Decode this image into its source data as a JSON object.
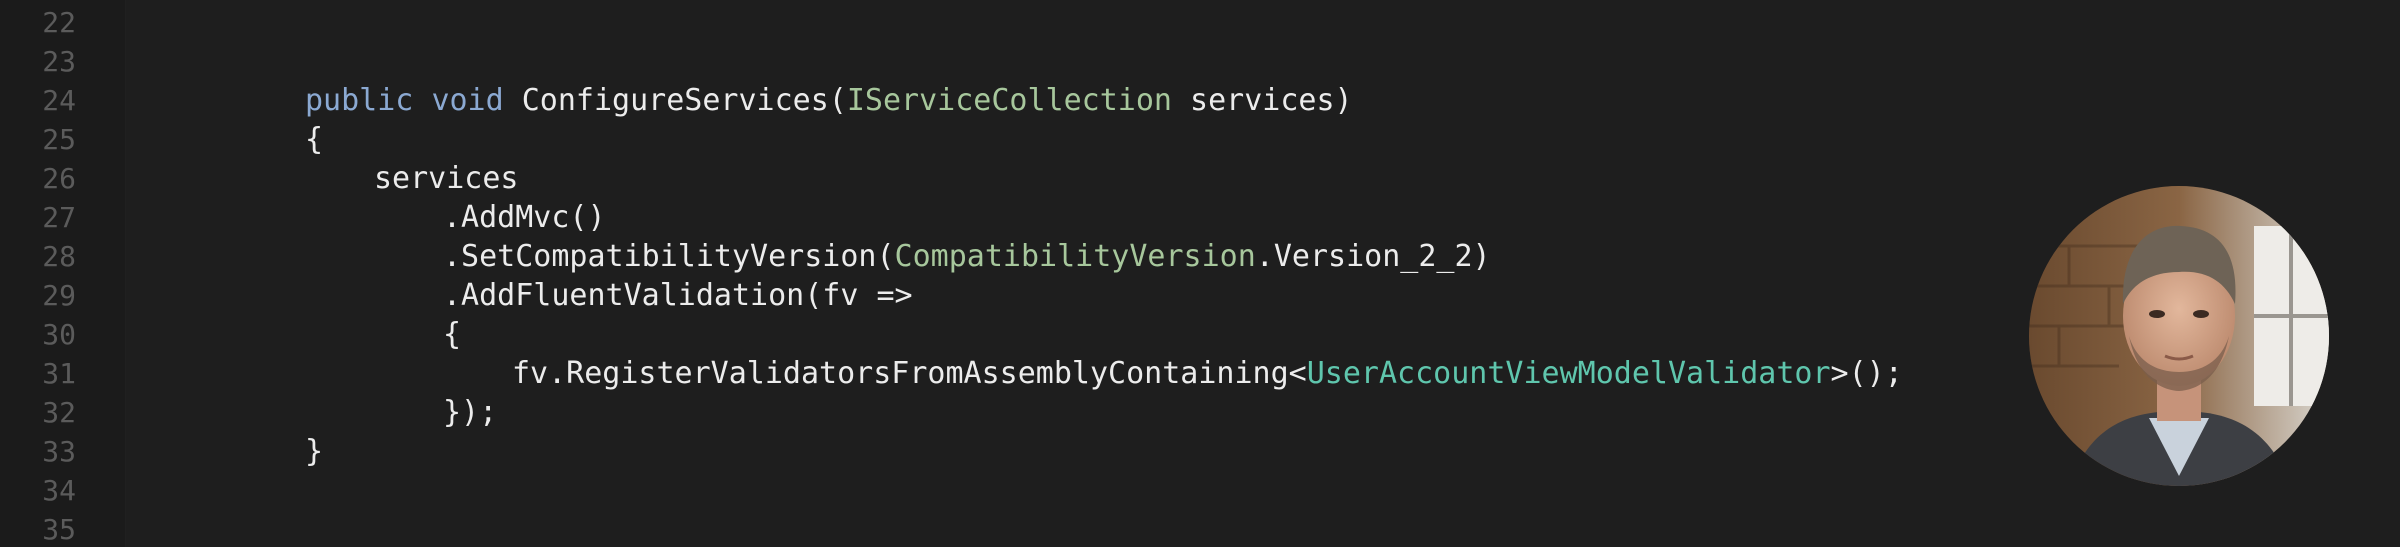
{
  "editor": {
    "line_numbers": [
      "22",
      "23",
      "24",
      "25",
      "26",
      "27",
      "28",
      "29",
      "30",
      "31",
      "32",
      "33",
      "34",
      "35"
    ],
    "lines": [
      {
        "segments": []
      },
      {
        "segments": []
      },
      {
        "indent": 2,
        "segments": [
          {
            "t": "public",
            "c": "kw"
          },
          {
            "t": " ",
            "c": "plain"
          },
          {
            "t": "void",
            "c": "kw"
          },
          {
            "t": " ConfigureServices(",
            "c": "plain"
          },
          {
            "t": "IServiceCollection",
            "c": "type"
          },
          {
            "t": " services)",
            "c": "plain"
          }
        ]
      },
      {
        "indent": 2,
        "segments": [
          {
            "t": "{",
            "c": "plain"
          }
        ]
      },
      {
        "indent": 3,
        "segments": [
          {
            "t": "services",
            "c": "plain"
          }
        ]
      },
      {
        "indent": 4,
        "segments": [
          {
            "t": ".AddMvc()",
            "c": "plain"
          }
        ]
      },
      {
        "indent": 4,
        "segments": [
          {
            "t": ".SetCompatibilityVersion(",
            "c": "plain"
          },
          {
            "t": "CompatibilityVersion",
            "c": "type"
          },
          {
            "t": ".Version_2_2)",
            "c": "plain"
          }
        ]
      },
      {
        "indent": 4,
        "segments": [
          {
            "t": ".AddFluentValidation(fv =>",
            "c": "plain"
          }
        ]
      },
      {
        "indent": 4,
        "segments": [
          {
            "t": "{",
            "c": "plain"
          }
        ]
      },
      {
        "indent": 5,
        "segments": [
          {
            "t": "fv.RegisterValidatorsFromAssemblyContaining<",
            "c": "plain"
          },
          {
            "t": "UserAccountViewModelValidator",
            "c": "cls"
          },
          {
            "t": ">();",
            "c": "plain"
          }
        ]
      },
      {
        "indent": 4,
        "segments": [
          {
            "t": "});",
            "c": "plain"
          }
        ]
      },
      {
        "indent": 2,
        "segments": [
          {
            "t": "}",
            "c": "plain"
          }
        ]
      },
      {
        "segments": []
      },
      {
        "segments": []
      }
    ]
  },
  "avatar": {
    "icon": "presenter-photo"
  },
  "colors": {
    "background": "#1e1e1e",
    "line_number": "#5b5b5b",
    "keyword": "#8ba9d2",
    "type": "#a7c79c",
    "class": "#5fc6ad",
    "text": "#ececec"
  }
}
